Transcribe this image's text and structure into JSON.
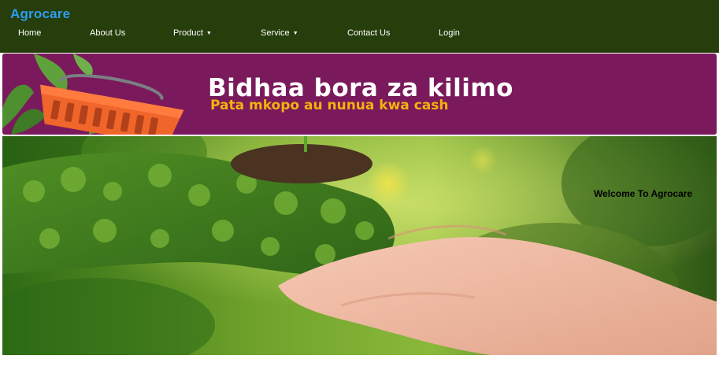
{
  "brand": {
    "name": "Agrocare",
    "color": "#2d9df0"
  },
  "nav": {
    "items": [
      {
        "label": "Home",
        "has_dropdown": false
      },
      {
        "label": "About Us",
        "has_dropdown": false
      },
      {
        "label": "Product",
        "has_dropdown": true
      },
      {
        "label": "Service",
        "has_dropdown": true
      },
      {
        "label": "Contact Us",
        "has_dropdown": false
      },
      {
        "label": "Login",
        "has_dropdown": false
      }
    ],
    "dropdown_glyph": "▼",
    "background": "#253e0b"
  },
  "banner": {
    "headline": "Bidhaa bora za kilimo",
    "subline": "Pata mkopo au nunua kwa cash",
    "icon": "shopping-basket-icon",
    "background": "#7a1a5c",
    "subline_color": "#f6b20c"
  },
  "hero": {
    "welcome": "Welcome To Agrocare",
    "image": "hands-holding-plant-earth-photo"
  }
}
